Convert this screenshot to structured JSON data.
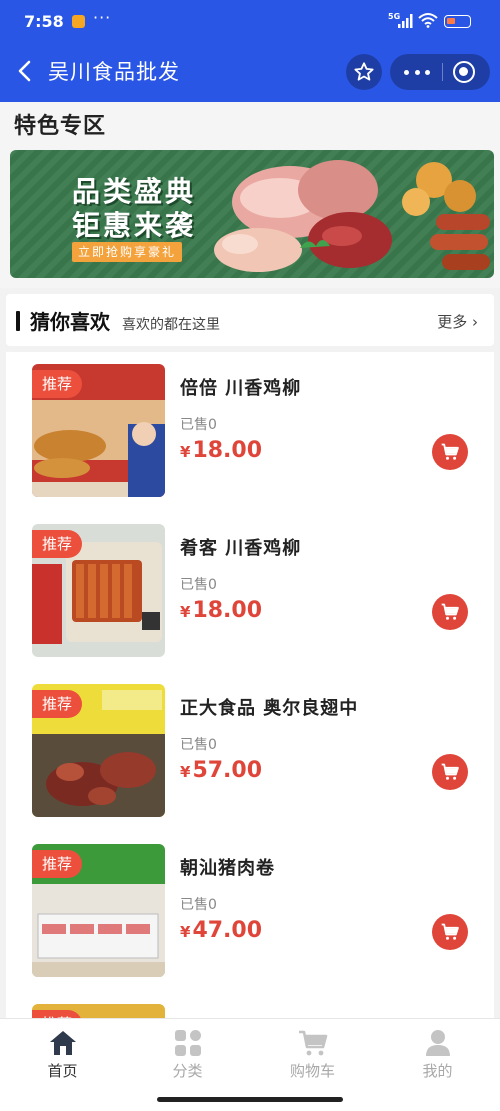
{
  "status_bar": {
    "time": "7:58",
    "more": "···",
    "network": "5G"
  },
  "navbar": {
    "title": "吴川食品批发",
    "back_icon": "chevron-left-icon",
    "favorite_icon": "star-icon",
    "more_icon": "more-dots-icon",
    "close_icon": "target-icon"
  },
  "special": {
    "title": "特色专区",
    "banner": {
      "line1": "品类盛典",
      "line2": "钜惠来袭",
      "cta": "立即抢购享豪礼"
    }
  },
  "guess": {
    "title": "猜你喜欢",
    "subtitle": "喜欢的都在这里",
    "more": "更多 ›"
  },
  "products": [
    {
      "tag": "推荐",
      "name": "倍倍 川香鸡柳",
      "sold": "已售0",
      "currency": "¥",
      "price": "18.00"
    },
    {
      "tag": "推荐",
      "name": "肴客 川香鸡柳",
      "sold": "已售0",
      "currency": "¥",
      "price": "18.00"
    },
    {
      "tag": "推荐",
      "name": "正大食品 奥尔良翅中",
      "sold": "已售0",
      "currency": "¥",
      "price": "57.00"
    },
    {
      "tag": "推荐",
      "name": "朝汕猪肉卷",
      "sold": "已售0",
      "currency": "¥",
      "price": "47.00"
    },
    {
      "tag": "推荐",
      "name": "",
      "sold": "",
      "currency": "",
      "price": ""
    }
  ],
  "tabs": [
    {
      "label": "首页",
      "icon": "home-icon",
      "active": true
    },
    {
      "label": "分类",
      "icon": "grid-icon",
      "active": false
    },
    {
      "label": "购物车",
      "icon": "cart-icon",
      "active": false
    },
    {
      "label": "我的",
      "icon": "user-icon",
      "active": false
    }
  ],
  "colors": {
    "header": "#2a56e6",
    "accent": "#e0453a",
    "tag": "#ec4f3c"
  }
}
